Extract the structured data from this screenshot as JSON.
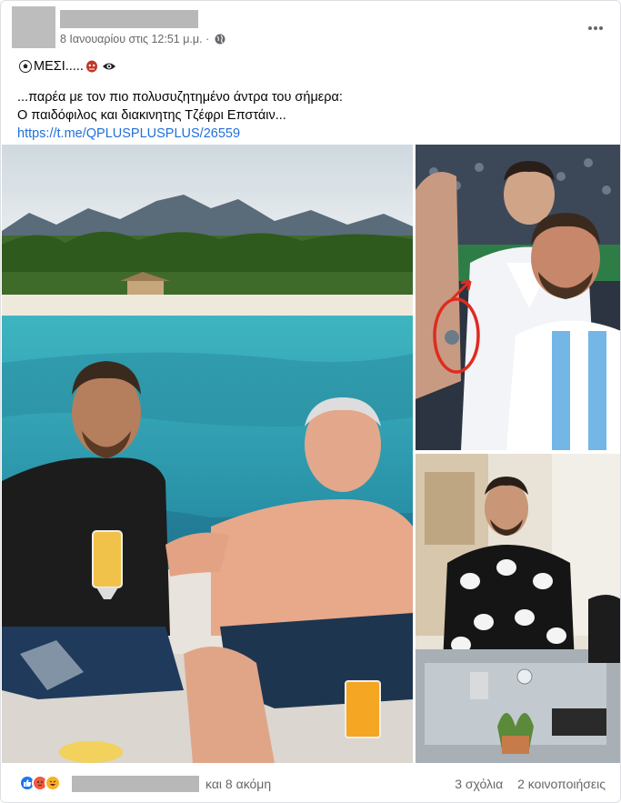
{
  "post": {
    "timestamp": "8 Ιανουαρίου στις 12:51 μ.μ.",
    "separator": "·",
    "line1_text": "ΜΕΣΙ.....",
    "line2": "...παρέα με τον πιο πολυσυζητημένο άντρα του σήμερα:",
    "line3": "Ο παιδόφιλος και διακινητης Τζέφρι Επστάιν...",
    "link": "https://t.me/QPLUSPLUSPLUS/26559"
  },
  "icons": {
    "more": "more-horizontal-icon",
    "audience": "globe-icon",
    "emoji_soccer": "soccer-ball-icon",
    "emoji_mask": "red-mask-icon",
    "emoji_eye": "eye-icon"
  },
  "photos": {
    "main": "Beach yacht photo",
    "top_right": "Stadium celebration photo",
    "bottom_right": "Restaurant table photo"
  },
  "footer": {
    "others": "και 8 ακόμη",
    "comments": "3 σχόλια",
    "shares": "2 κοινοποιήσεις"
  },
  "colors": {
    "link": "#216fdb",
    "meta": "#65676b",
    "like": "#1877f2",
    "angry": "#f0593e",
    "haha": "#f7b125"
  }
}
